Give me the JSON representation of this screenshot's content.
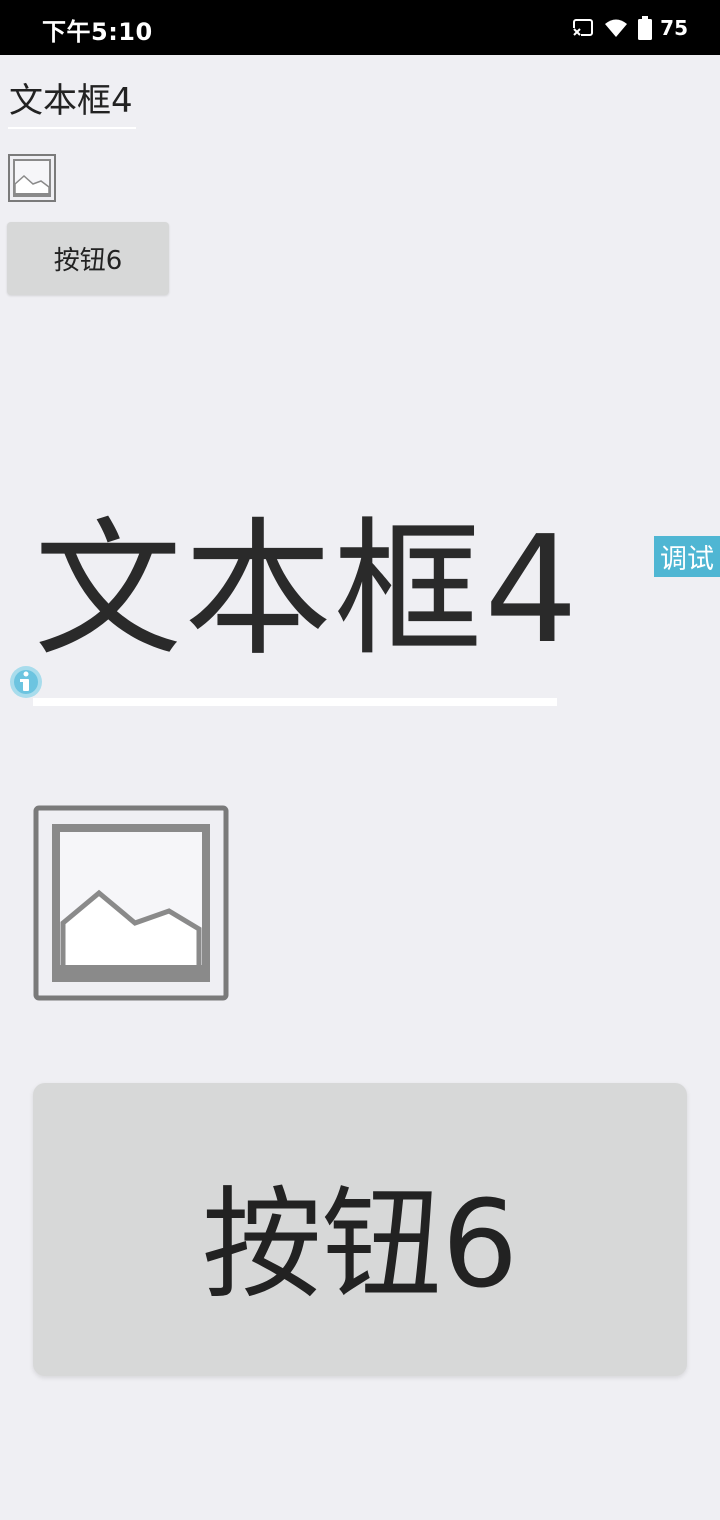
{
  "status_bar": {
    "time": "下午5:10",
    "battery_level": "75",
    "icons": [
      "cast-icon",
      "wifi-icon",
      "battery-icon"
    ]
  },
  "small": {
    "text_field": "文本框4",
    "image_icon": "image-placeholder-icon",
    "button_label": "按钮6"
  },
  "debug_tag": "调试",
  "info_icon": "info-icon",
  "large": {
    "text_field": "文本框4",
    "image_icon": "image-placeholder-icon",
    "button_label": "按钮6"
  },
  "colors": {
    "background": "#efeff3",
    "button": "#d7d8d8",
    "debug_tag": "#4fb6d3",
    "status_bar": "#000000"
  }
}
